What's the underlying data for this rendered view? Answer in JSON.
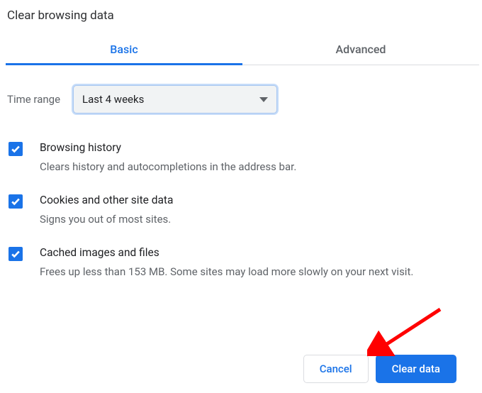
{
  "title": "Clear browsing data",
  "tabs": {
    "basic": "Basic",
    "advanced": "Advanced"
  },
  "time_range": {
    "label": "Time range",
    "value": "Last 4 weeks"
  },
  "options": [
    {
      "title": "Browsing history",
      "desc": "Clears history and autocompletions in the address bar."
    },
    {
      "title": "Cookies and other site data",
      "desc": "Signs you out of most sites."
    },
    {
      "title": "Cached images and files",
      "desc": "Frees up less than 153 MB. Some sites may load more slowly on your next visit."
    }
  ],
  "buttons": {
    "cancel": "Cancel",
    "clear": "Clear data"
  }
}
